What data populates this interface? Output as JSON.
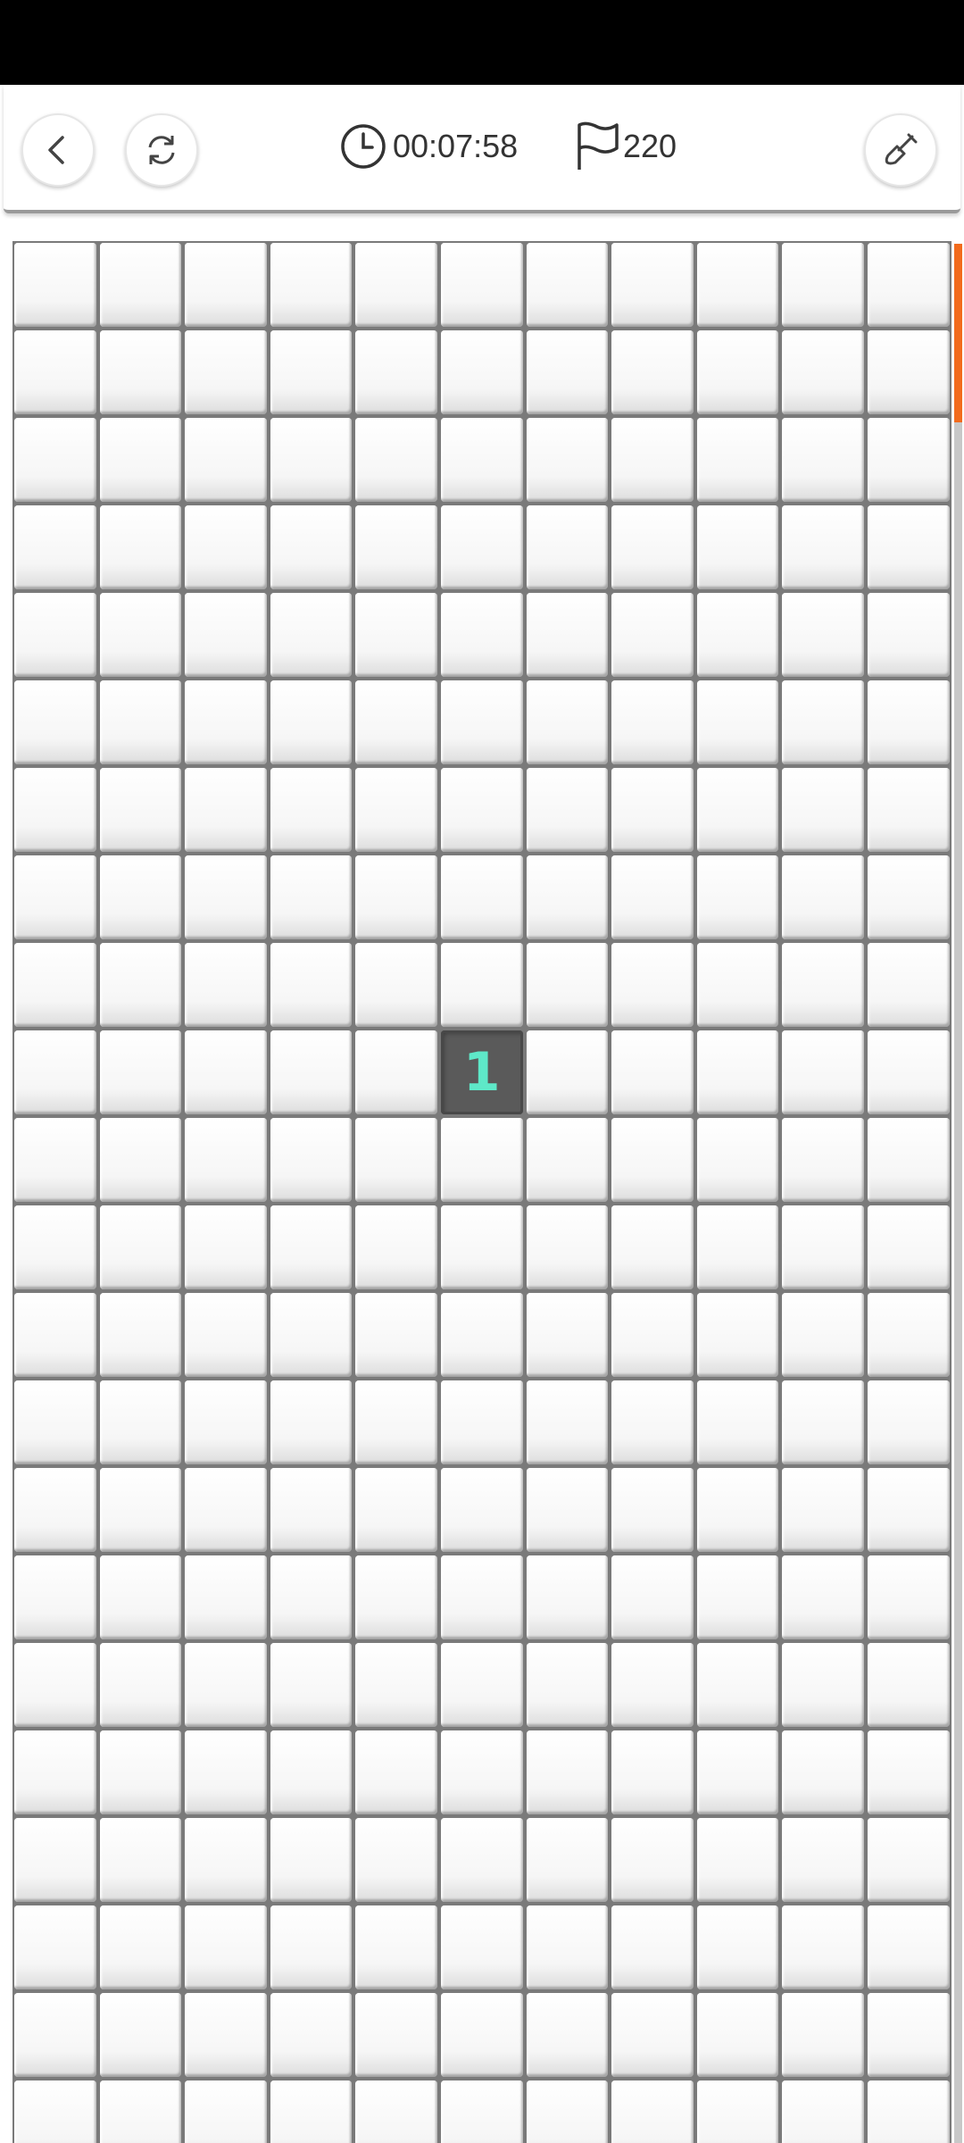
{
  "toolbar": {
    "timer": "00:07:58",
    "flags": "220"
  },
  "icons": {
    "back": "chevron-left-icon",
    "restart": "refresh-icon",
    "clock": "clock-icon",
    "flag": "flag-icon",
    "tool": "shovel-icon"
  },
  "board": {
    "columns": 11,
    "visible_rows": 22,
    "revealed": [
      {
        "row": 10,
        "col": 6,
        "value": "1"
      }
    ]
  },
  "colors": {
    "accent": "#f26b1d",
    "number_1": "#5ee8c8",
    "revealed_cell": "#5a5a5a"
  }
}
